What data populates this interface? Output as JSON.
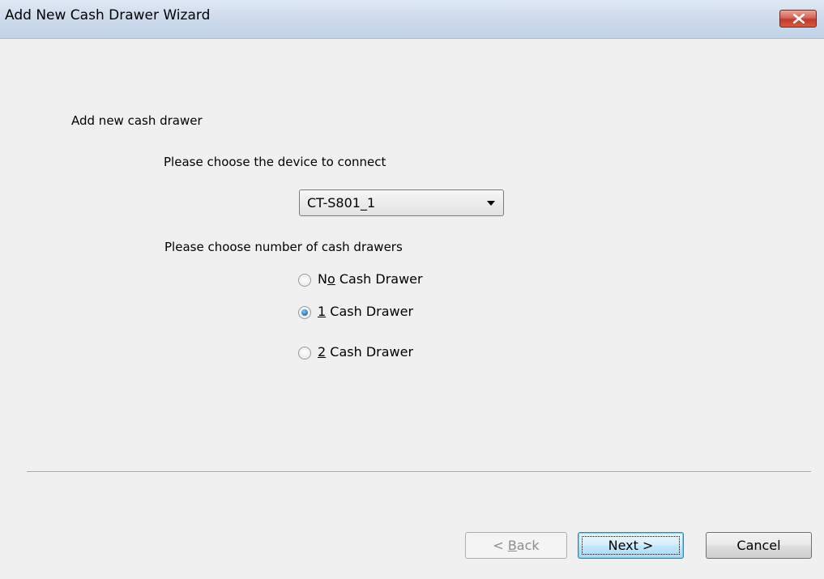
{
  "window": {
    "title": "Add New Cash Drawer Wizard",
    "close_icon": "close-x-icon"
  },
  "heading": "Add new cash drawer",
  "device": {
    "label": "Please choose the device to connect",
    "selected": "CT-S801_1"
  },
  "drawers": {
    "label": "Please choose number of cash drawers",
    "options": [
      {
        "pre": "N",
        "mnemonic": "o",
        "post": " Cash Drawer",
        "checked": false
      },
      {
        "pre": "",
        "mnemonic": "1",
        "post": " Cash Drawer",
        "checked": true
      },
      {
        "pre": "",
        "mnemonic": "2",
        "post": " Cash Drawer",
        "checked": false
      }
    ]
  },
  "buttons": {
    "back": {
      "pre": "< ",
      "mnemonic": "B",
      "post": "ack"
    },
    "next": "Next >",
    "cancel": "Cancel"
  }
}
